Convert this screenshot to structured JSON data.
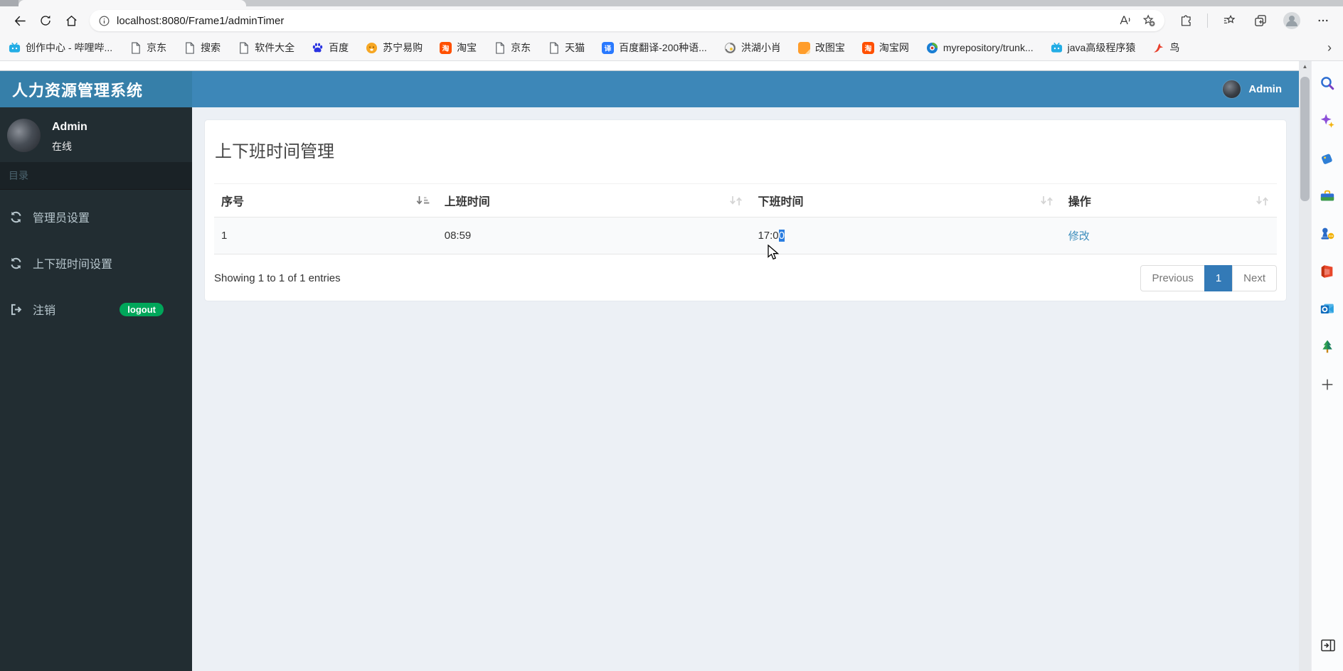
{
  "browser": {
    "url": "localhost:8080/Frame1/adminTimer",
    "bookmarks": [
      {
        "label": "创作中心 - 哔哩哔...",
        "icon": "bilibili-icon"
      },
      {
        "label": "京东",
        "icon": "page-icon"
      },
      {
        "label": "搜索",
        "icon": "page-icon"
      },
      {
        "label": "软件大全",
        "icon": "page-icon"
      },
      {
        "label": "百度",
        "icon": "baidu-icon"
      },
      {
        "label": "苏宁易购",
        "icon": "suning-icon"
      },
      {
        "label": "淘宝",
        "icon": "taobao-icon"
      },
      {
        "label": "京东",
        "icon": "page-icon"
      },
      {
        "label": "天猫",
        "icon": "page-icon"
      },
      {
        "label": "百度翻译-200种语...",
        "icon": "translate-icon"
      },
      {
        "label": "洪湖小肖",
        "icon": "swirl-icon"
      },
      {
        "label": "改图宝",
        "icon": "gaitubao-icon"
      },
      {
        "label": "淘宝网",
        "icon": "taobao-icon"
      },
      {
        "label": "myrepository/trunk...",
        "icon": "repo-icon"
      },
      {
        "label": "java高级程序猿",
        "icon": "bilibili-icon"
      },
      {
        "label": "鸟",
        "icon": "bird-icon"
      }
    ],
    "bookmarks_overflow_chevron": "›"
  },
  "app": {
    "logo_title": "人力资源管理系统",
    "navbar_user": "Admin",
    "sidebar": {
      "user_name": "Admin",
      "user_status": "在线",
      "menu_header": "目录",
      "items": [
        {
          "label": "管理员设置",
          "icon": "refresh-icon",
          "badge": null
        },
        {
          "label": "上下班时间设置",
          "icon": "refresh-icon",
          "badge": null
        },
        {
          "label": "注销",
          "icon": "signout-icon",
          "badge": "logout"
        }
      ]
    },
    "content": {
      "page_title": "上下班时间管理",
      "table": {
        "columns": [
          {
            "label": "序号",
            "sort": "asc",
            "width": "21%"
          },
          {
            "label": "上班时间",
            "sort": "none",
            "width": "29.5%"
          },
          {
            "label": "下班时间",
            "sort": "none",
            "width": "29.2%"
          },
          {
            "label": "操作",
            "sort": "none",
            "width": "20.3%"
          }
        ],
        "rows": [
          {
            "seq": "1",
            "work_start": "08:59",
            "work_end_prefix": "17:0",
            "work_end_selected": "0",
            "action": "修改"
          }
        ]
      },
      "info": "Showing 1 to 1 of 1 entries",
      "pagination": {
        "previous": "Previous",
        "page": "1",
        "next": "Next"
      }
    }
  },
  "edge_sidebar": {
    "icons": [
      "search-icon",
      "copilot-icon",
      "shopping-icon",
      "toolbox-icon",
      "games-icon",
      "office-icon",
      "outlook-icon",
      "tree-icon",
      "add-icon"
    ]
  },
  "colors": {
    "navbar_blue": "#3d87b8",
    "logo_blue": "#367fa9",
    "sidebar_dark": "#222d32",
    "logout_green": "#00a65a",
    "link_blue": "#3c8dbc",
    "pagination_active_blue": "#337ab7",
    "selection_blue": "#2a7de1",
    "content_bg": "#ecf0f5"
  }
}
